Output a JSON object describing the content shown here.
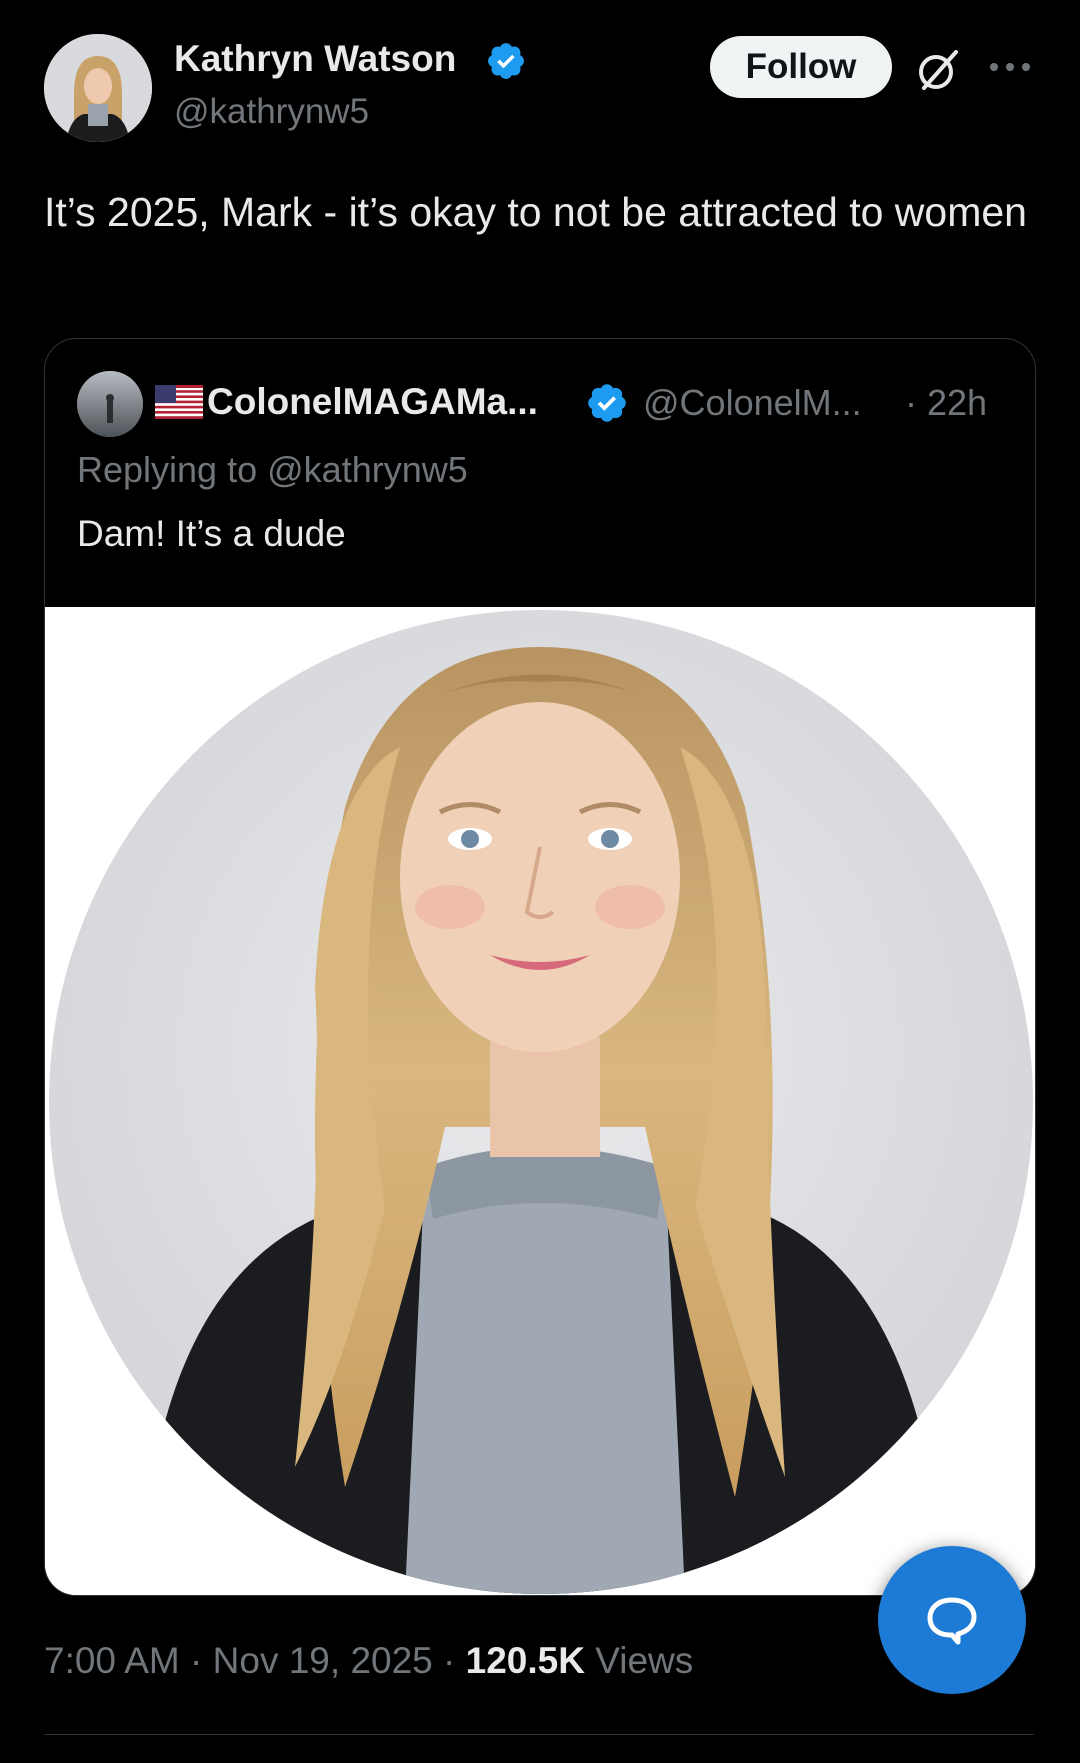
{
  "tweet": {
    "author": {
      "name": "Kathryn Watson",
      "handle": "@kathrynw5"
    },
    "follow_label": "Follow",
    "text": "It’s 2025, Mark - it’s okay to not be attracted to women",
    "time": "7:00 AM",
    "date": "Nov 19, 2025",
    "sep": "·",
    "views_count": "120.5K",
    "views_label": "Views"
  },
  "quote": {
    "author_name": "ColonelMAGAMa...",
    "handle": "@ColonelM...",
    "time": "· 22h",
    "reply_prefix": "Replying to",
    "reply_handle": "@kathrynw5",
    "text": "Dam! It’s a dude"
  },
  "colors": {
    "accent": "#1d9bf0",
    "fab": "#1d7bd6",
    "muted": "#71767b",
    "text": "#e7e9ea"
  },
  "icons": [
    "verified-badge-icon",
    "grok-icon",
    "more-icon",
    "us-flag-icon",
    "reply-icon"
  ]
}
